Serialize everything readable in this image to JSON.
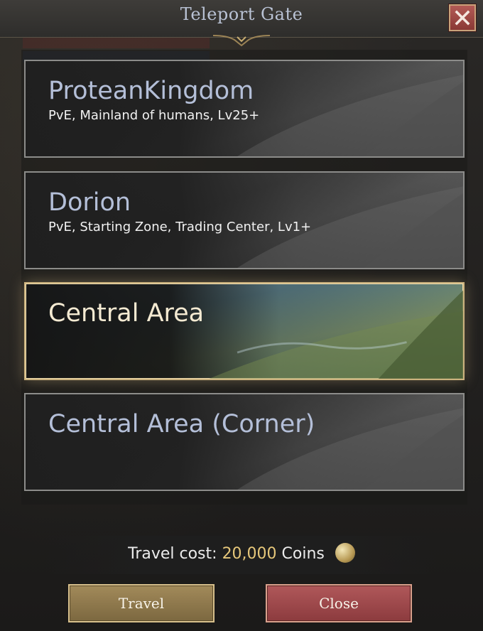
{
  "window": {
    "title": "Teleport Gate",
    "close_icon": "close-icon"
  },
  "destinations": [
    {
      "name": "ProteanKingdom",
      "description": "PvE, Mainland of humans, Lv25+",
      "selected": false
    },
    {
      "name": "Dorion",
      "description": "PvE, Starting Zone, Trading Center, Lv1+",
      "selected": false
    },
    {
      "name": "Central Area",
      "description": "",
      "selected": true
    },
    {
      "name": "Central Area (Corner)",
      "description": "",
      "selected": false
    }
  ],
  "cost": {
    "label": "Travel cost:",
    "amount": "20,000",
    "unit": "Coins",
    "icon": "coin-icon"
  },
  "buttons": {
    "travel": "Travel",
    "close": "Close"
  },
  "colors": {
    "accent_gold": "#cbb27e",
    "close_red": "#b35a55",
    "title_blue": "#b9c2d4"
  }
}
